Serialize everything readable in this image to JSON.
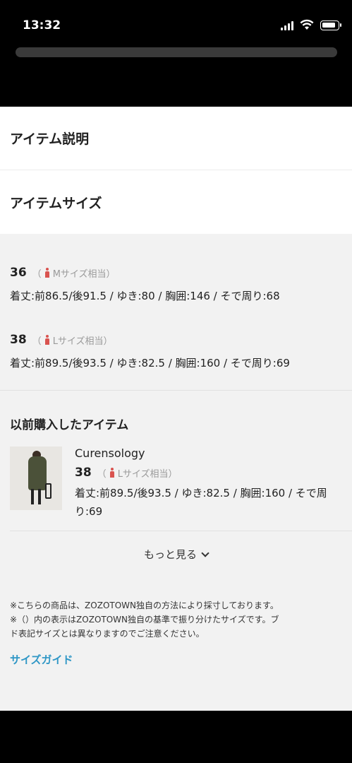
{
  "status_bar": {
    "time": "13:32"
  },
  "sections": {
    "item_description": "アイテム説明",
    "item_size": "アイテムサイズ"
  },
  "sizes": [
    {
      "size": "36",
      "hint_open": "（",
      "hint": "Mサイズ相当",
      "hint_close": "）",
      "detail": "着丈:前86.5/後91.5 / ゆき:80 / 胸囲:146 / そで周り:68"
    },
    {
      "size": "38",
      "hint_open": "（",
      "hint": "Lサイズ相当",
      "hint_close": "）",
      "detail": "着丈:前89.5/後93.5 / ゆき:82.5 / 胸囲:160 / そで周り:69"
    }
  ],
  "previous": {
    "title": "以前購入したアイテム",
    "brand": "Curensology",
    "size": "38",
    "hint_open": "（",
    "hint": "Lサイズ相当",
    "hint_close": "）",
    "detail_line1": "着丈:前89.5/後93.5 / ゆき:82.5 / 胸囲:160 / そで周",
    "detail_line2": "り:69"
  },
  "more": {
    "label": "もっと見る"
  },
  "notes": {
    "line1": "※こちらの商品は、ZOZOTOWN独自の方法により採寸しております。",
    "line2": "※（）内の表示はZOZOTOWN独自の基準で振り分けたサイズです。ブ",
    "line3": "ド表記サイズとは異なりますのでご注意ください。"
  },
  "size_guide": {
    "label": "サイズガイド"
  },
  "colors": {
    "link": "#2f97c6",
    "person_icon": "#d9534f"
  }
}
